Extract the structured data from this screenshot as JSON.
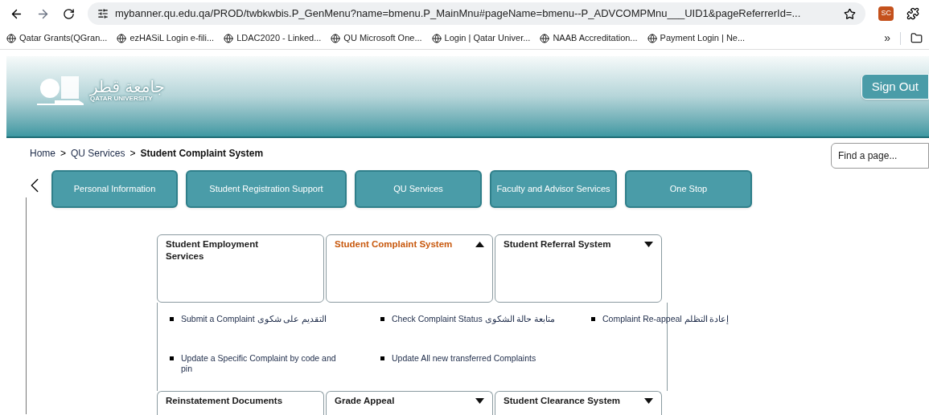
{
  "browser": {
    "address": "mybanner.qu.edu.qa/PROD/twbkwbis.P_GenMenu?name=bmenu.P_MainMnu#pageName=bmenu--P_ADVCOMPMnu___UID1&pageReferrerId=...",
    "profile": "SC",
    "bookmarks": [
      "Qatar Grants(QGran...",
      "ezHASiL Login e-fili...",
      "LDAC2020 - Linked...",
      "QU Microsoft One...",
      "Login | Qatar Univer...",
      "NAAB Accreditation...",
      "Payment Login | Ne..."
    ],
    "more": "»"
  },
  "header": {
    "logo_arabic": "جامعة قطر",
    "logo_english": "QATAR UNIVERSITY",
    "sign_out": "Sign Out"
  },
  "breadcrumb": [
    {
      "label": "Home",
      "current": false
    },
    {
      "label": "QU Services",
      "current": false
    },
    {
      "label": "Student Complaint System",
      "current": true
    }
  ],
  "breadcrumb_separator": ">",
  "search": {
    "placeholder": "Find a page..."
  },
  "nav": [
    "Personal Information",
    "Student Registration Support",
    "QU Services",
    "Faculty and Advisor Services",
    "One Stop"
  ],
  "tiles": [
    {
      "label": "Student Employment Services",
      "selected": false,
      "kind": "plain"
    },
    {
      "label": "Student Complaint System",
      "selected": true,
      "kind": "menu",
      "expanded": true
    },
    {
      "label": "Student Referral System",
      "selected": false,
      "kind": "menu",
      "expanded": false
    }
  ],
  "submenu": [
    {
      "label": "Submit a Complaint التقديم على شكوى"
    },
    {
      "label": "Check Complaint Status متابعة حالة الشكوى"
    },
    {
      "label": "Complaint Re-appeal إعادة التظلم"
    },
    {
      "label": "Update a Specific Complaint by code and pin"
    },
    {
      "label": "Update All new transferred Complaints"
    }
  ],
  "tiles_2": [
    {
      "label": "Reinstatement Documents",
      "selected": false,
      "kind": "plain"
    },
    {
      "label": "Grade Appeal",
      "selected": false,
      "kind": "menu",
      "expanded": false
    },
    {
      "label": "Student Clearance System",
      "selected": false,
      "kind": "menu",
      "expanded": false
    }
  ]
}
